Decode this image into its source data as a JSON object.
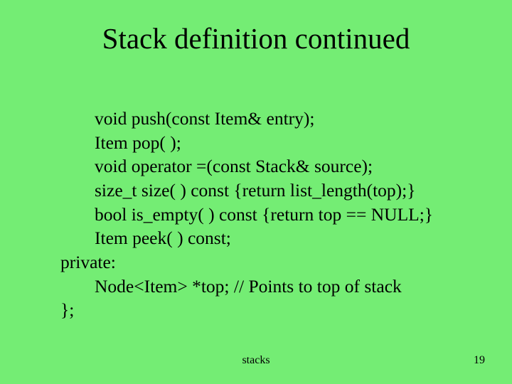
{
  "slide": {
    "title": "Stack definition continued",
    "lines": [
      "void push(const Item& entry);",
      "Item pop( );",
      "void operator =(const Stack& source);",
      "size_t size( ) const {return list_length(top);}",
      "bool is_empty( ) const {return top == NULL;}",
      "Item peek( ) const;",
      "private:",
      "Node<Item> *top;  // Points to top of stack",
      "};"
    ],
    "footer": {
      "center": "stacks",
      "page": "19"
    }
  }
}
